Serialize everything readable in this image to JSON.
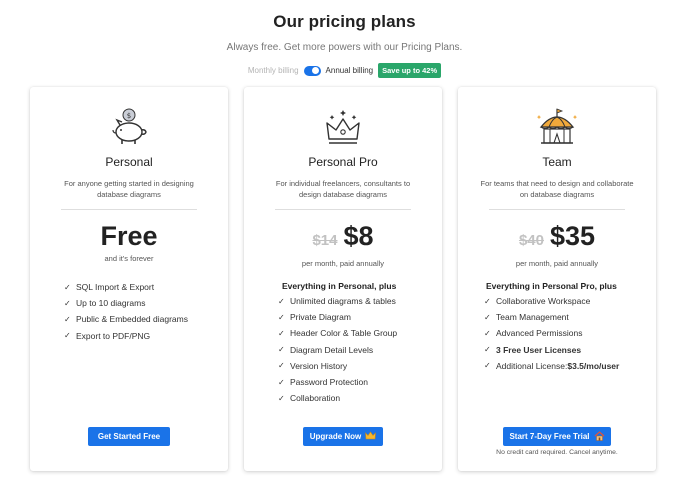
{
  "header": {
    "title": "Our pricing plans",
    "subtitle": "Always free. Get more powers with our Pricing Plans."
  },
  "billing": {
    "monthly_label": "Monthly billing",
    "annual_label": "Annual billing",
    "selected": "annual",
    "save_badge": "Save up to 42%",
    "accent_color": "#1a73e8",
    "badge_color": "#2aa66a"
  },
  "plans": [
    {
      "name": "Personal",
      "icon": "piggy-bank-icon",
      "description": "For anyone getting started in designing database diagrams",
      "price": "Free",
      "price_note": "and it's forever",
      "features": [
        "SQL Import & Export",
        "Up to 10 diagrams",
        "Public & Embedded diagrams",
        "Export to PDF/PNG"
      ],
      "cta_label": "Get Started Free"
    },
    {
      "name": "Personal Pro",
      "icon": "crown-icon",
      "description": "For individual freelancers, consultants to design database diagrams",
      "old_price": "$14",
      "price": "$8",
      "price_note": "per month, paid annually",
      "features_heading": "Everything in Personal, plus",
      "features": [
        "Unlimited diagrams & tables",
        "Private Diagram",
        "Header Color & Table Group",
        "Diagram Detail Levels",
        "Version History",
        "Password Protection",
        "Collaboration"
      ],
      "cta_label": "Upgrade Now",
      "cta_icon": "crown-emoji-icon"
    },
    {
      "name": "Team",
      "icon": "circus-tent-icon",
      "description": "For teams that need to design and collaborate on database diagrams",
      "old_price": "$40",
      "price": "$35",
      "price_note": "per month, paid annually",
      "features_heading": "Everything in Personal Pro, plus",
      "features": [
        "Collaborative Workspace",
        "Team Management",
        "Advanced Permissions",
        "3 Free User Licenses"
      ],
      "extra_feature_prefix": "Additional License: ",
      "extra_feature_value": "$3.5/mo/user",
      "cta_label": "Start 7-Day Free Trial",
      "cta_icon": "house-emoji-icon",
      "cta_note": "No credit card required. Cancel anytime."
    }
  ]
}
